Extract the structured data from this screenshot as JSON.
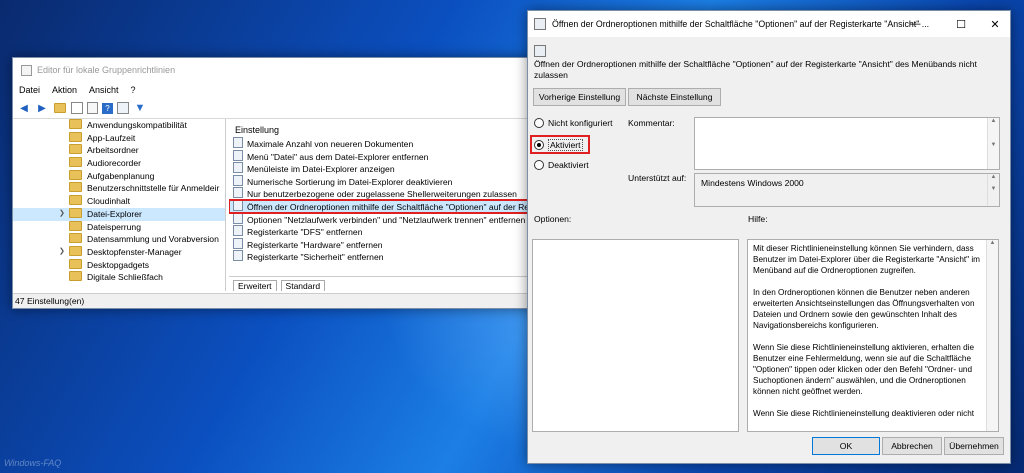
{
  "gpo": {
    "title": "Editor für lokale Gruppenrichtlinien",
    "menu": [
      "Datei",
      "Aktion",
      "Ansicht",
      "?"
    ],
    "tree": [
      {
        "label": "Anwendungskompatibilität",
        "expandable": false
      },
      {
        "label": "App-Laufzeit",
        "expandable": false
      },
      {
        "label": "Arbeitsordner",
        "expandable": false
      },
      {
        "label": "Audiorecorder",
        "expandable": false
      },
      {
        "label": "Aufgabenplanung",
        "expandable": false
      },
      {
        "label": "Benutzerschnittstelle für Anmeldeir",
        "expandable": false
      },
      {
        "label": "Cloudinhalt",
        "expandable": false
      },
      {
        "label": "Datei-Explorer",
        "expandable": true,
        "selected": true
      },
      {
        "label": "Dateisperrung",
        "expandable": false
      },
      {
        "label": "Datensammlung und Vorabversion",
        "expandable": false
      },
      {
        "label": "Desktopfenster-Manager",
        "expandable": true
      },
      {
        "label": "Desktopgadgets",
        "expandable": false
      },
      {
        "label": "Digitale Schließfach",
        "expandable": false
      }
    ],
    "list_header": "Einstellung",
    "settings": [
      "Maximale Anzahl von neueren Dokumenten",
      "Menü \"Datei\" aus dem Datei-Explorer entfernen",
      "Menüleiste im Datei-Explorer anzeigen",
      "Numerische Sortierung im Datei-Explorer deaktivieren",
      "Nur benutzerbezogene oder zugelassene Shellerweiterungen zulassen",
      "Öffnen der Ordneroptionen mithilfe der Schaltfläche \"Optionen\" auf der Regi",
      "Optionen \"Netzlaufwerk verbinden\" und \"Netzlaufwerk trennen\" entfernen",
      "Registerkarte \"DFS\" entfernen",
      "Registerkarte \"Hardware\" entfernen",
      "Registerkarte \"Sicherheit\" entfernen"
    ],
    "highlighted_index": 5,
    "tabs": [
      "Erweitert",
      "Standard"
    ],
    "status": "47 Einstellung(en)"
  },
  "dialog": {
    "title": "Öffnen der Ordneroptionen mithilfe der Schaltfläche \"Optionen\" auf der Registerkarte \"Ansicht\" ...",
    "heading": "Öffnen der Ordneroptionen mithilfe der Schaltfläche \"Optionen\" auf der Registerkarte \"Ansicht\" des Menübands nicht zulassen",
    "prev_button": "Vorherige Einstellung",
    "next_button": "Nächste Einstellung",
    "radio_not_configured": "Nicht konfiguriert",
    "radio_enabled": "Aktiviert",
    "radio_disabled": "Deaktiviert",
    "selected_radio": "Aktiviert",
    "comment_label": "Kommentar:",
    "supported_label": "Unterstützt auf:",
    "supported_value": "Mindestens Windows 2000",
    "options_label": "Optionen:",
    "help_label": "Hilfe:",
    "help_paragraphs": [
      "Mit dieser Richtlinieneinstellung können Sie verhindern, dass Benutzer im Datei-Explorer über die Registerkarte \"Ansicht\" im Menüband auf die Ordneroptionen zugreifen.",
      "In den Ordneroptionen können die Benutzer neben anderen erweiterten Ansichtseinstellungen das Öffnungsverhalten von Dateien und Ordnern sowie den gewünschten Inhalt des Navigationsbereichs konfigurieren.",
      "Wenn Sie diese Richtlinieneinstellung aktivieren, erhalten die Benutzer eine Fehlermeldung, wenn sie auf die Schaltfläche \"Optionen\" tippen oder klicken oder den Befehl \"Ordner- und Suchoptionen ändern\" auswählen, und die Ordneroptionen können nicht geöffnet werden.",
      "Wenn Sie diese Richtlinieneinstellung deaktivieren oder nicht"
    ],
    "ok": "OK",
    "cancel": "Abbrechen",
    "apply": "Übernehmen"
  },
  "desktop": {
    "watermark": "Windows-FAQ"
  },
  "colors": {
    "highlight_border": "#e02020",
    "selection": "#cce8ff",
    "desktop_blue": "#0b4fbf"
  }
}
